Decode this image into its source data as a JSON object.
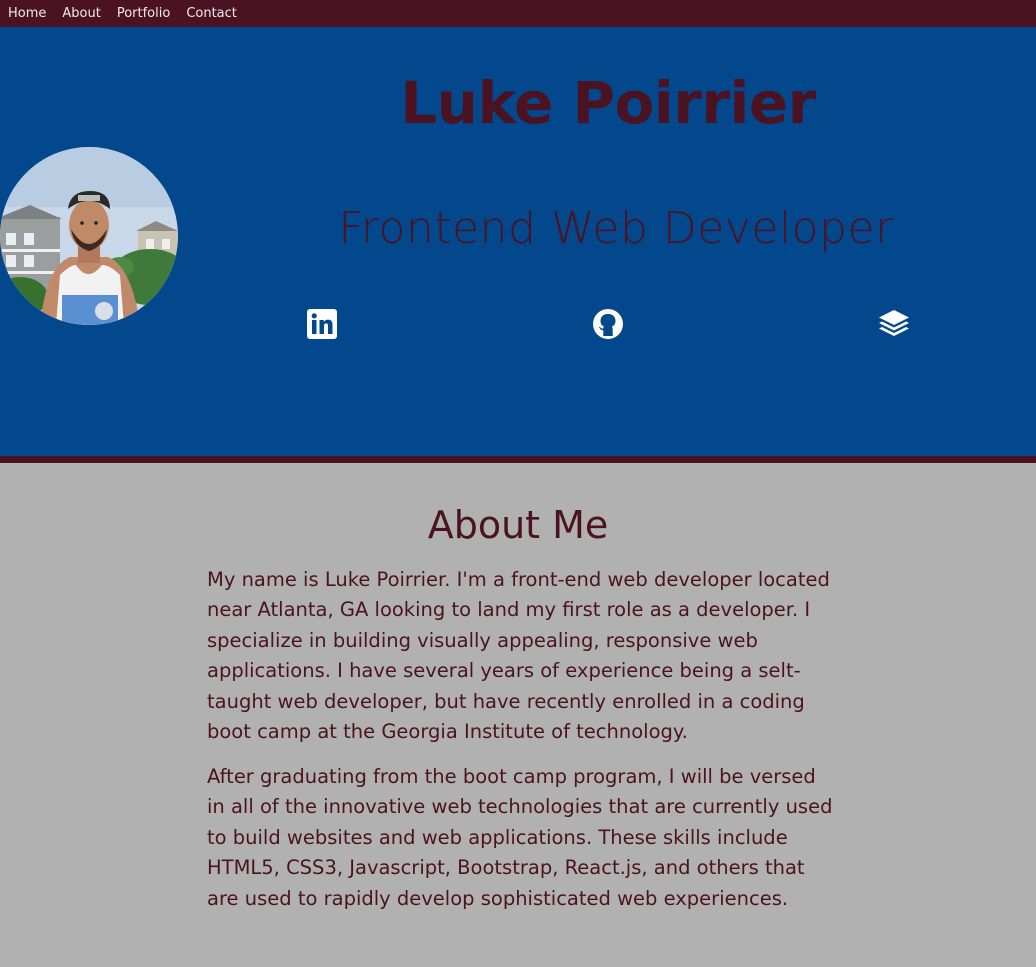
{
  "nav": {
    "items": [
      {
        "label": "Home"
      },
      {
        "label": "About"
      },
      {
        "label": "Portfolio"
      },
      {
        "label": "Contact"
      }
    ]
  },
  "hero": {
    "name": "Luke Poirrier",
    "title": "Frontend Web Developer",
    "avatar_icon": "profile-photo",
    "social": [
      {
        "icon": "linkedin-icon"
      },
      {
        "icon": "github-icon"
      },
      {
        "icon": "stack-icon"
      }
    ]
  },
  "about": {
    "heading": "About Me",
    "paragraph_1": "My name is Luke Poirrier. I'm a front-end web developer located near Atlanta, GA looking to land my first role as a developer. I specialize in building visually appealing, responsive web applications. I have several years of experience being a selt-taught web developer, but have recently enrolled in a coding boot camp at the Georgia Institute of technology.",
    "paragraph_2": "After graduating from the boot camp program, I will be versed in all of the innovative web technologies that are currently used to build websites and web applications. These skills include HTML5, CSS3, Javascript, Bootstrap, React.js, and others that are used to rapidly develop sophisticated web experiences."
  },
  "colors": {
    "maroon": "#4b1322",
    "hero_blue": "#03488c",
    "about_bg": "#b1b1b1",
    "icon_white": "#ffffff"
  }
}
